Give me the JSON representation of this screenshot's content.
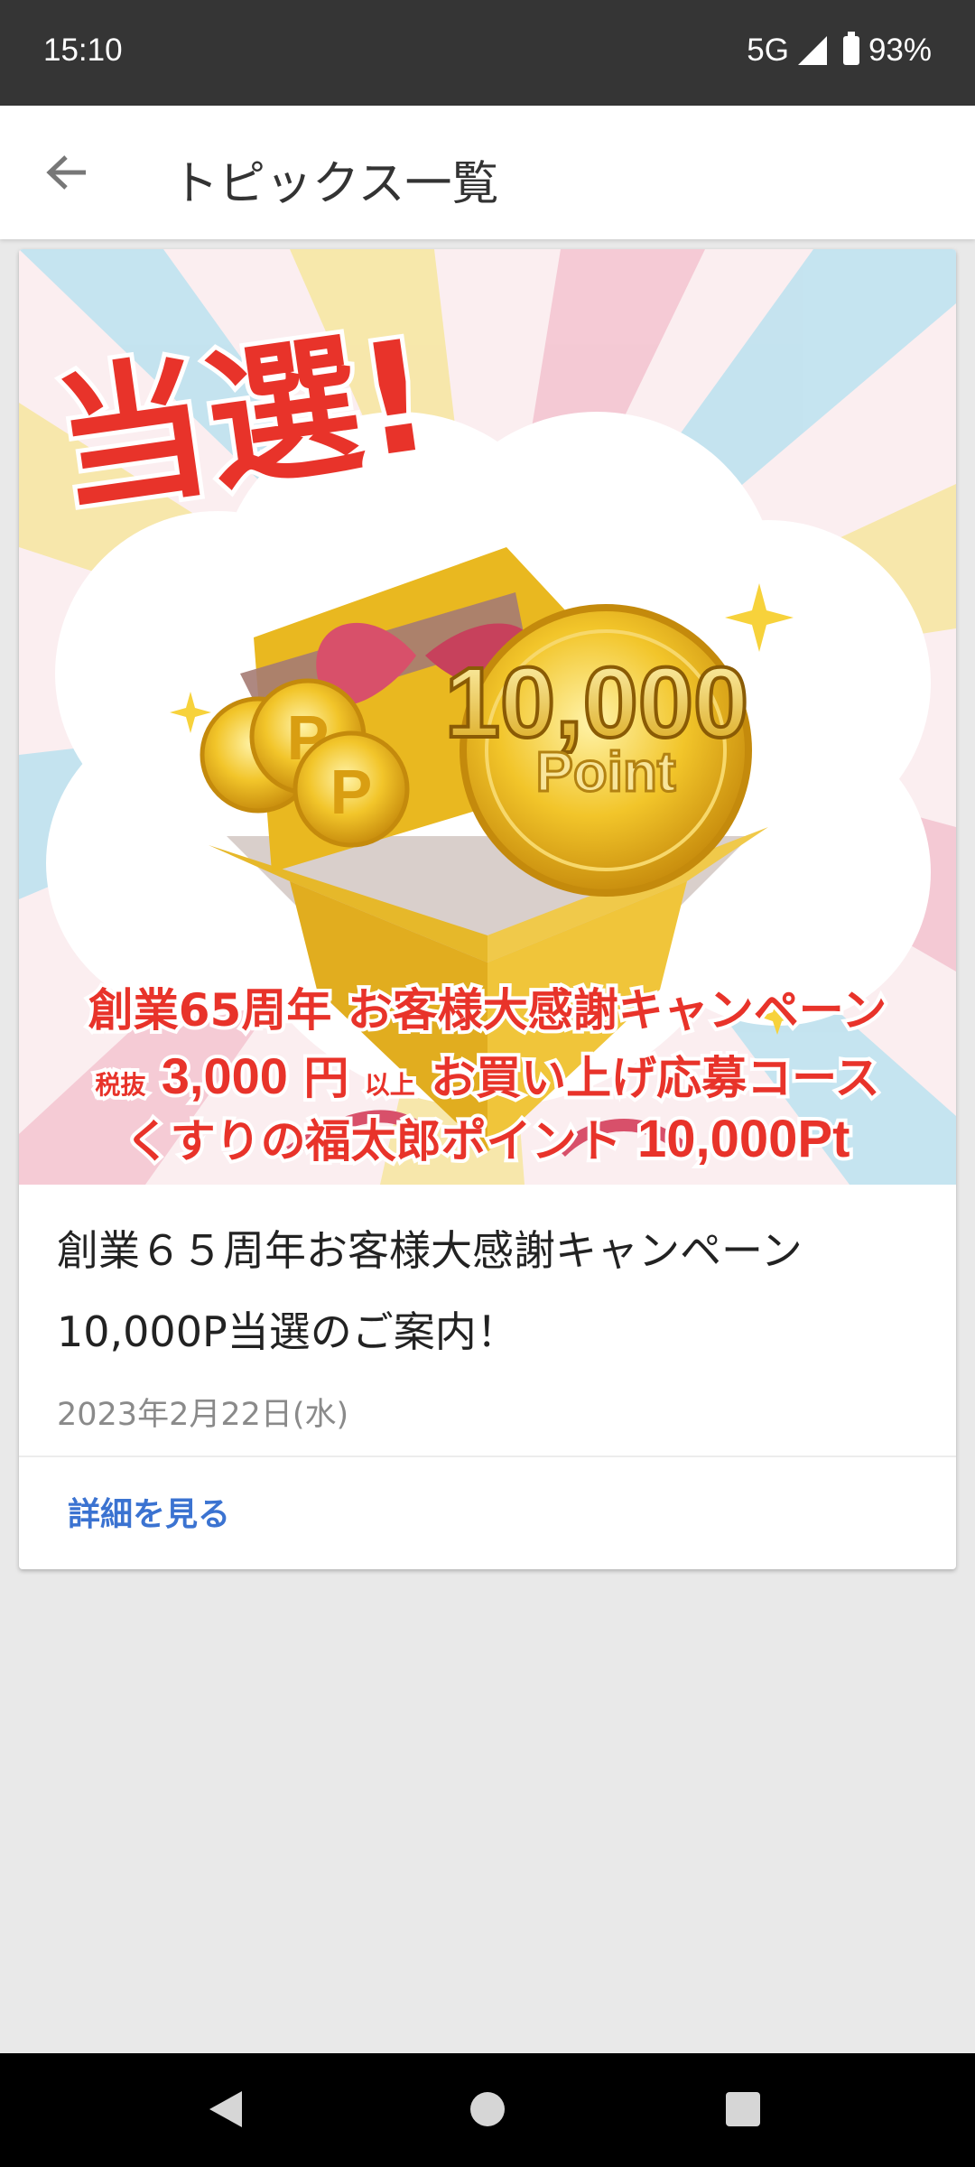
{
  "status": {
    "time": "15:10",
    "network": "5G",
    "battery": "93%"
  },
  "app_bar": {
    "title": "トピックス一覧",
    "back_icon": "arrow-left-icon"
  },
  "card": {
    "banner": {
      "headline": "当選!",
      "coin_amount": "10,000",
      "coin_unit": "Point",
      "coin_letter": "P",
      "line1": "創業65周年 お客様大感謝キャンペーン",
      "line2_prefix": "税抜",
      "line2_amount": "3,000",
      "line2_unit": "円",
      "line2_small": "以上",
      "line2_rest": "お買い上げ応募コース",
      "line3_text": "くすりの福太郎ポイント",
      "line3_amount": "10,000Pt"
    },
    "title_line1": "創業６５周年お客様大感謝キャンペーン",
    "title_line2": "10,000P当選のご案内！",
    "date": "2023年2月22日(水)",
    "detail_label": "詳細を見る"
  },
  "colors": {
    "accent_link": "#3b73d1",
    "banner_red": "#e8332a",
    "gold": "#e9b820"
  }
}
